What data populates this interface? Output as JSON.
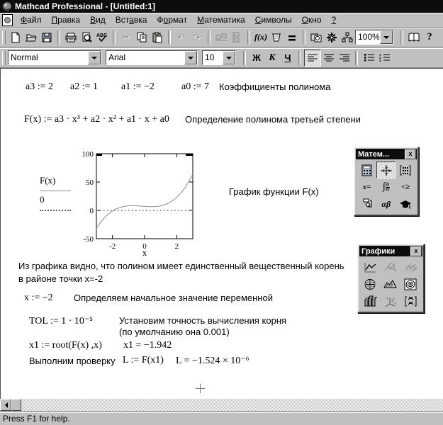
{
  "window": {
    "title": "Mathcad Professional - [Untitled:1]",
    "app_icon": "mathcad-logo"
  },
  "menu": {
    "items": [
      {
        "pre": "",
        "u": "Ф",
        "post": "айл"
      },
      {
        "pre": "",
        "u": "П",
        "post": "равка"
      },
      {
        "pre": "",
        "u": "В",
        "post": "ид"
      },
      {
        "pre": "Вст",
        "u": "а",
        "post": "вка"
      },
      {
        "pre": "Ф",
        "u": "о",
        "post": "рмат"
      },
      {
        "pre": "",
        "u": "М",
        "post": "атематика"
      },
      {
        "pre": "",
        "u": "С",
        "post": "имволы"
      },
      {
        "pre": "",
        "u": "О",
        "post": "кно"
      },
      {
        "pre": "",
        "u": "?",
        "post": ""
      }
    ]
  },
  "toolbar": {
    "buttons": [
      "new",
      "open",
      "save",
      "print",
      "print-preview",
      "check-spelling",
      "cut",
      "copy",
      "paste",
      "undo",
      "redo",
      "align-across",
      "align-down",
      "insert-function",
      "insert-unit",
      "evaluate",
      "insert-component",
      "wizard",
      "mathconnex",
      "zoom",
      "resource-center",
      "help"
    ],
    "zoom_value": "100%",
    "insert_function_label": "f(x)",
    "help_label": "?"
  },
  "formatbar": {
    "style_value": "Normal",
    "font_value": "Arial",
    "size_value": "10",
    "bold_label": "Ж",
    "italic_label": "K",
    "underline_label": "Ч"
  },
  "worksheet": {
    "coeff_a3": "a3 := 2",
    "coeff_a2": "a2 := 1",
    "coeff_a1": "a1 := −2",
    "coeff_a0": "a0 := 7",
    "coeff_comment": "Коэффициенты полинома",
    "poly_def": "F(x) := a3 · x³ + a2 · x² + a1 · x + a0",
    "poly_comment": "Определение полинома третьей степени",
    "graph_caption": "График функции F(x)",
    "note_line1": "Из графика видно, что полином имеет единственный вещественный корень",
    "note_line2": "в районе точки x=-2",
    "x_def": "x := −2",
    "x_def_comment": "Определяем начальное значение переменной",
    "tol_def": "TOL := 1 · 10⁻⁵",
    "tol_comment_line1": "Установим точность вычисления корня",
    "tol_comment_line2": "(по умолчанию она 0.001)",
    "x1_def": "x1 := root(F(x) ,x)",
    "x1_result": "x1 = −1.942",
    "check_label": "Выполним проверку",
    "L_def": "L := F(x1)",
    "L_result": "L = −1.524 × 10⁻⁶"
  },
  "chart_data": {
    "type": "line",
    "title": "",
    "xlabel": "x",
    "ylabel": "",
    "xlim": [
      -3,
      3
    ],
    "ylim": [
      -50,
      100
    ],
    "xticks": [
      -2,
      0,
      2
    ],
    "yticks": [
      100,
      50,
      0,
      -50
    ],
    "grid": false,
    "legend_position": "left",
    "series": [
      {
        "name": "F(x)",
        "style": "solid",
        "color": "#909090",
        "function": "F(x) = 2x^3 + x^2 - 2x + 7",
        "points": [
          [
            -3,
            -32
          ],
          [
            -2.75,
            -21.53
          ],
          [
            -2.5,
            -13
          ],
          [
            -2.25,
            -6.22
          ],
          [
            -2,
            -1
          ],
          [
            -1.75,
            2.84
          ],
          [
            -1.5,
            5.5
          ],
          [
            -1.25,
            7.16
          ],
          [
            -1,
            8
          ],
          [
            -0.75,
            8.22
          ],
          [
            -0.5,
            8
          ],
          [
            -0.25,
            7.53
          ],
          [
            0,
            7
          ],
          [
            0.25,
            6.59
          ],
          [
            0.5,
            6.5
          ],
          [
            0.75,
            6.91
          ],
          [
            1,
            8
          ],
          [
            1.25,
            9.97
          ],
          [
            1.5,
            13
          ],
          [
            1.75,
            17.28
          ],
          [
            2,
            23
          ],
          [
            2.25,
            30.34
          ],
          [
            2.5,
            39.5
          ],
          [
            2.75,
            50.66
          ],
          [
            3,
            64
          ]
        ]
      },
      {
        "name": "0",
        "style": "dotted",
        "color": "#606060",
        "points": [
          [
            -3,
            0
          ],
          [
            3,
            0
          ]
        ]
      }
    ]
  },
  "math_palette": {
    "title": "Матем...",
    "buttons": [
      "calculator",
      "graph",
      "matrix",
      "evaluation",
      "calculus",
      "boolean",
      "programming",
      "greek",
      "symbolic"
    ],
    "active_button": "graph",
    "evaluation_label": "x=",
    "greek_label": "αβ",
    "boolean_label": "<≥"
  },
  "graph_palette": {
    "title": "Графики",
    "buttons": [
      "xy-plot",
      "zoom-plot",
      "trace-plot",
      "polar-plot",
      "surface-plot",
      "contour-plot",
      "3d-bar-plot",
      "3d-scatter-plot",
      "vector-field-plot"
    ],
    "disabled_buttons": [
      "zoom-plot",
      "trace-plot"
    ]
  },
  "statusbar": {
    "text": "Press F1 for help."
  }
}
